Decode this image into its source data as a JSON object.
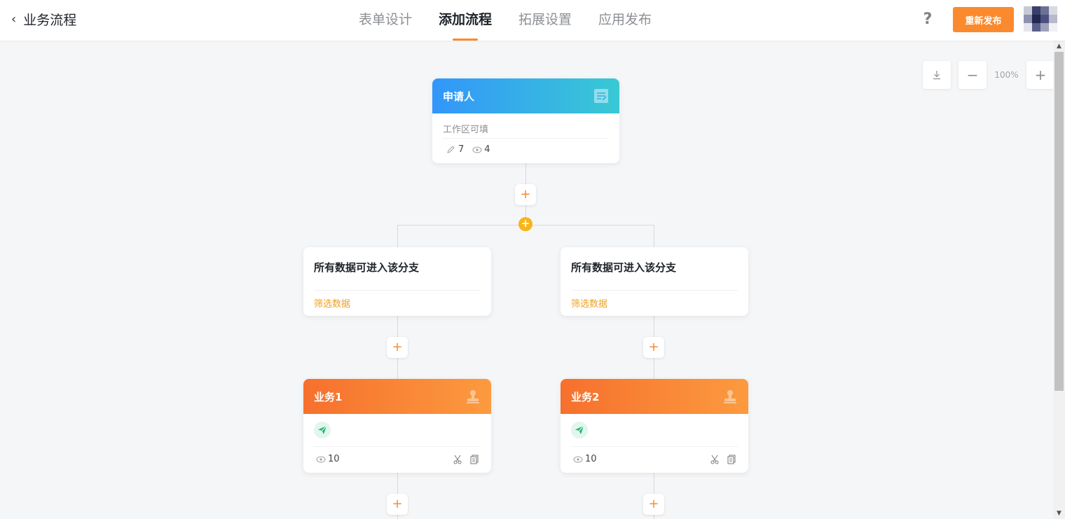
{
  "header": {
    "back_icon": "chevron-left-icon",
    "title": "业务流程",
    "tabs": [
      {
        "label": "表单设计",
        "active": false
      },
      {
        "label": "添加流程",
        "active": true
      },
      {
        "label": "拓展设置",
        "active": false
      },
      {
        "label": "应用发布",
        "active": false
      }
    ],
    "help_label": "?",
    "publish_label": "重新发布"
  },
  "colors": {
    "accent": "#fa8a2d",
    "applicant_gradient": [
      "#3296fa",
      "#39c9d4"
    ],
    "business_gradient": [
      "#f6702d",
      "#fc9a3f"
    ],
    "branch_link": "#f0a020",
    "add_branch": "#f8b419"
  },
  "zoom": {
    "download_icon": "download-icon",
    "minus_label": "−",
    "level": "100%",
    "plus_label": "+"
  },
  "flow": {
    "applicant": {
      "title": "申请人",
      "icon": "form-icon",
      "subtitle": "工作区可填",
      "edit_count": "7",
      "view_count": "4"
    },
    "add_label": "+",
    "branches": [
      {
        "condition_title": "所有数据可进入该分支",
        "filter_link": "筛选数据",
        "task": {
          "title": "业务1",
          "icon": "stamp-icon",
          "view_count": "10"
        }
      },
      {
        "condition_title": "所有数据可进入该分支",
        "filter_link": "筛选数据",
        "task": {
          "title": "业务2",
          "icon": "stamp-icon",
          "view_count": "10"
        }
      }
    ]
  }
}
